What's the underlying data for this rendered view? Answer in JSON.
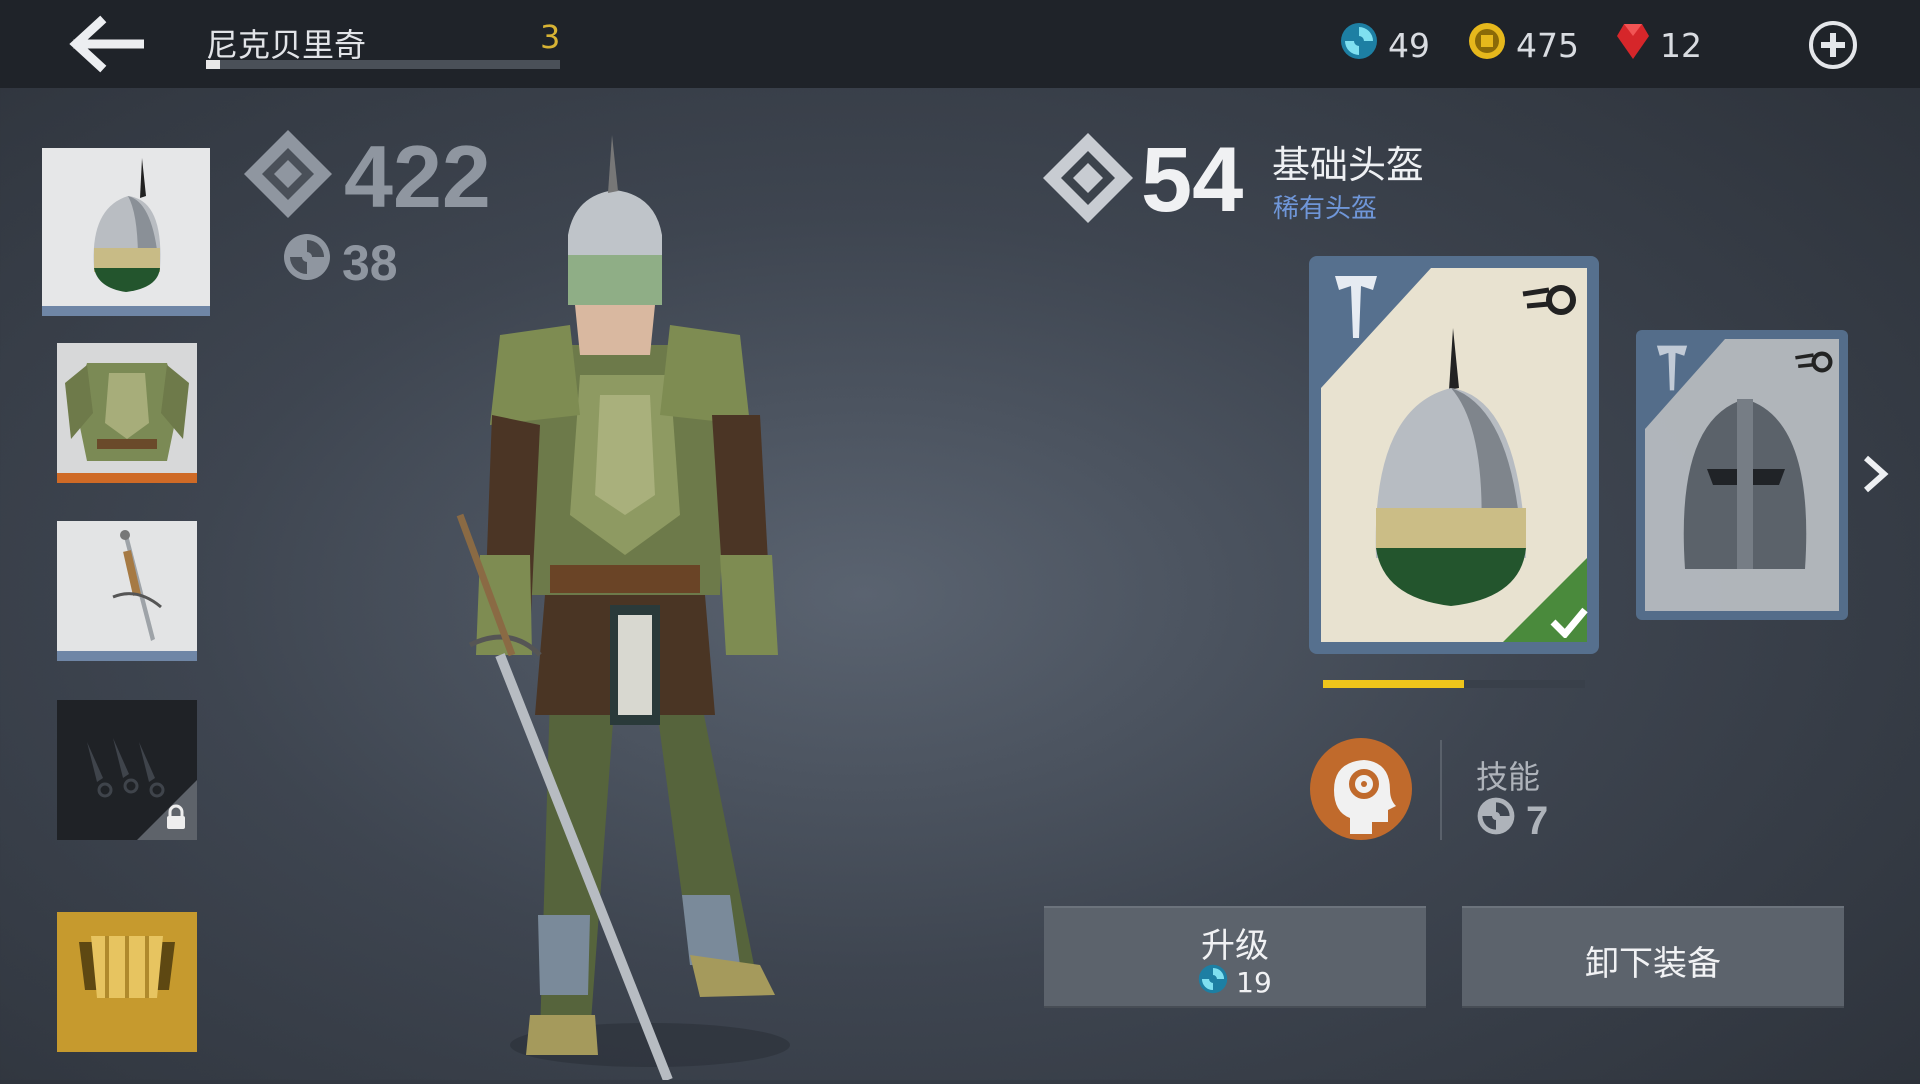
{
  "header": {
    "player_name": "尼克贝里奇",
    "player_level": "3",
    "level_progress": 0.04,
    "currencies": [
      {
        "name": "essence",
        "icon": "essence-icon",
        "value": "49",
        "color": "#2aa6c8"
      },
      {
        "name": "coins",
        "icon": "coin-icon",
        "value": "475",
        "color": "#e6b81c"
      },
      {
        "name": "gems",
        "icon": "ruby-icon",
        "value": "12",
        "color": "#d6262a"
      }
    ]
  },
  "equipment_slots": [
    {
      "name": "helmet",
      "icon": "helmet-icon",
      "selected": true,
      "bar_color": "#6f86a6"
    },
    {
      "name": "armor",
      "icon": "armor-icon",
      "selected": false,
      "bar_color": "#cf6a26"
    },
    {
      "name": "weapon",
      "icon": "sword-icon",
      "selected": false,
      "bar_color": "#6f86a6"
    },
    {
      "name": "ranged",
      "icon": "kunai-icon",
      "locked": true
    },
    {
      "name": "magic",
      "icon": "scroll-icon"
    }
  ],
  "character": {
    "total_power": "422",
    "total_skill": "38"
  },
  "item": {
    "power": "54",
    "name": "基础头盔",
    "rarity": "稀有头盔",
    "rarity_color": "#6f96d8",
    "upgrade_progress": 0.54,
    "skill_label": "技能",
    "skill_value": "7"
  },
  "actions": {
    "upgrade_label": "升级",
    "upgrade_cost": "19",
    "unequip_label": "卸下装备"
  }
}
